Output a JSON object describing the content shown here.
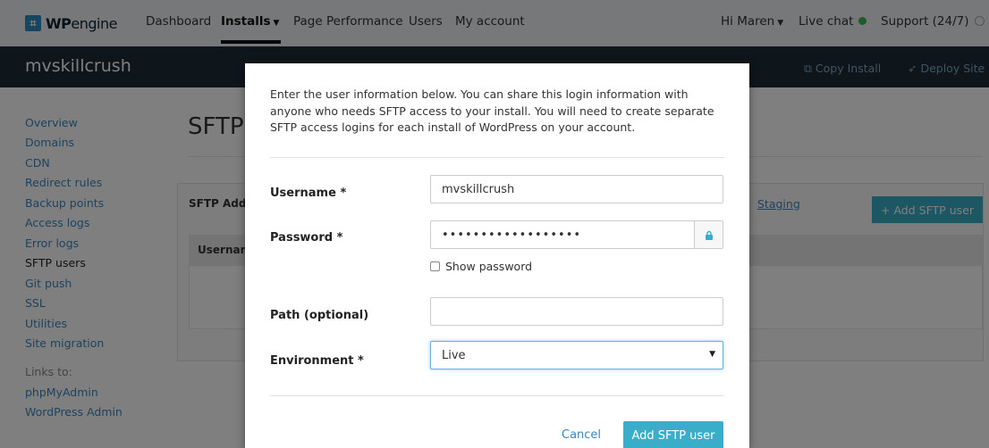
{
  "topnav": {
    "logo_bold": "WP",
    "logo_light": "engine",
    "logo_icon": "wpengine-logo-icon",
    "items": [
      {
        "label": "Dashboard"
      },
      {
        "label": "Installs"
      },
      {
        "label": "Page Performance"
      },
      {
        "label": "Users"
      },
      {
        "label": "My account"
      }
    ],
    "greeting": "Hi Maren",
    "live_chat": "Live chat",
    "support": "Support (24/7)",
    "live_dot_color": "#3fb950"
  },
  "header": {
    "site_name": "mvskillcrush",
    "copy_install": "Copy Install",
    "deploy_site": "Deploy Site"
  },
  "sidebar": {
    "items": [
      {
        "label": "Overview"
      },
      {
        "label": "Domains"
      },
      {
        "label": "CDN"
      },
      {
        "label": "Redirect rules"
      },
      {
        "label": "Backup points"
      },
      {
        "label": "Access logs"
      },
      {
        "label": "Error logs"
      },
      {
        "label": "SFTP users"
      },
      {
        "label": "Git push"
      },
      {
        "label": "SSL"
      },
      {
        "label": "Utilities"
      },
      {
        "label": "Site migration"
      }
    ],
    "links_label": "Links to:",
    "links": [
      {
        "label": "phpMyAdmin"
      },
      {
        "label": "WordPress Admin"
      }
    ]
  },
  "main": {
    "title_partial": "SFTP",
    "panel_head_partial": "SFTP Add",
    "staging_link": "Staging",
    "add_button": "Add SFTP user",
    "table_header_partial": "Usernam"
  },
  "modal": {
    "intro": "Enter the user information below. You can share this login information with anyone who needs SFTP access to your install. You will need to create separate SFTP access logins for each install of WordPress on your account.",
    "username_label": "Username *",
    "username_value": "mvskillcrush",
    "password_label": "Password *",
    "password_value": "••••••••••••••••••",
    "show_password_label": "Show password",
    "path_label": "Path (optional)",
    "path_value": "",
    "environment_label": "Environment *",
    "environment_value": "Live",
    "cancel_label": "Cancel",
    "submit_label": "Add SFTP user"
  },
  "colors": {
    "accent": "#3aaec9",
    "link": "#3a86c0",
    "header_bg": "#1d2a36"
  }
}
